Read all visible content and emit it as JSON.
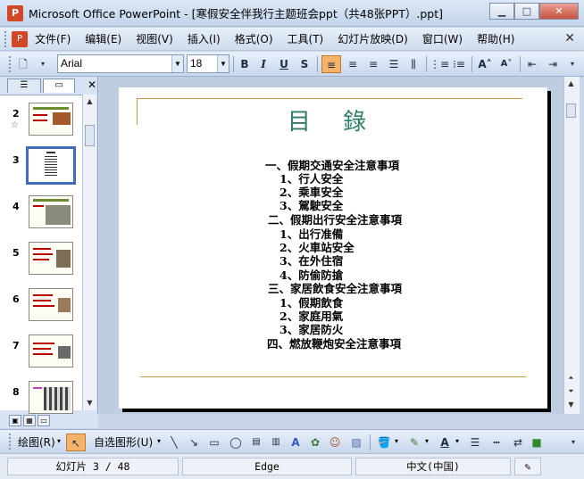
{
  "window": {
    "title": "Microsoft Office PowerPoint - [寒假安全伴我行主题班会ppt（共48张PPT）.ppt]",
    "app_icon": "powerpoint-icon",
    "min_label": "▁",
    "max_label": "□",
    "close_label": "✕"
  },
  "menu": {
    "items": [
      "文件(F)",
      "编辑(E)",
      "视图(V)",
      "插入(I)",
      "格式(O)",
      "工具(T)",
      "幻灯片放映(D)",
      "窗口(W)",
      "帮助(H)"
    ],
    "close_label": "✕"
  },
  "format_toolbar": {
    "font_name": "Arial",
    "font_size": "18",
    "bold": "B",
    "italic": "I",
    "underline": "U",
    "shadow": "S"
  },
  "slides_pane": {
    "close_label": "✕",
    "thumbs": [
      {
        "num": "2",
        "star": "☆"
      },
      {
        "num": "3",
        "star": ""
      },
      {
        "num": "4",
        "star": ""
      },
      {
        "num": "5",
        "star": ""
      },
      {
        "num": "6",
        "star": ""
      },
      {
        "num": "7",
        "star": ""
      },
      {
        "num": "8",
        "star": ""
      }
    ]
  },
  "slide": {
    "title": "目 錄",
    "lines": [
      "一、假期交通安全注意事項",
      "1、行人安全",
      "2、乘車安全",
      "3、駕駛安全",
      "二、假期出行安全注意事項",
      "1、出行准備",
      "2、火車站安全",
      "3、在外住宿",
      "4、防偷防搶",
      "三、家居飲食安全注意事項",
      "1、假期飲食",
      "2、家庭用氣",
      "3、家居防火",
      "四、燃放鞭炮安全注意事項"
    ]
  },
  "draw_toolbar": {
    "draw_label": "绘图(R)",
    "autoshapes_label": "自选图形(U)"
  },
  "status": {
    "slide_info": "幻灯片 3 / 48",
    "design": "Edge",
    "language": "中文(中国)"
  },
  "colors": {
    "title_green": "#2e7d6a",
    "rule_gold": "#c59a3c",
    "selection_blue": "#3f6cbf",
    "active_button": "#f5b26a"
  }
}
